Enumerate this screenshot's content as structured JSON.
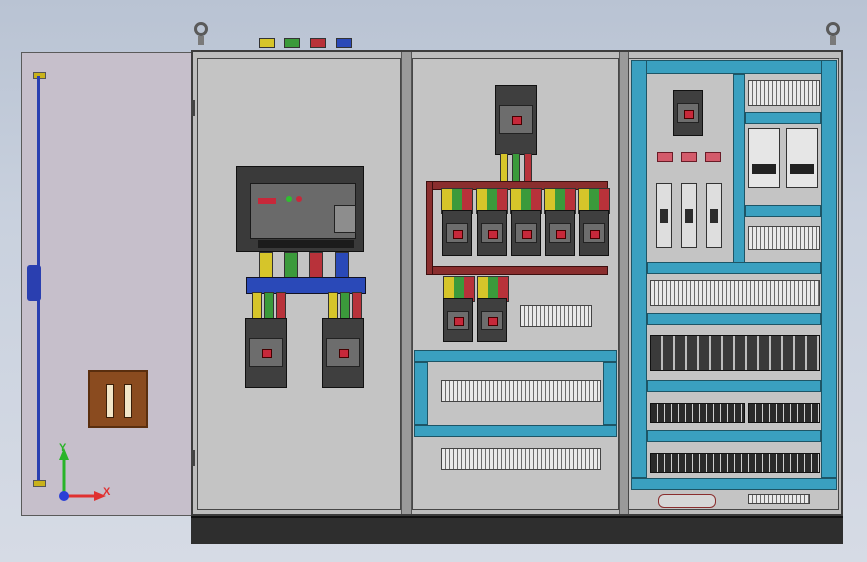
{
  "scene": {
    "description_free": true,
    "busbar_colors": {
      "phase_l1": "#d6c52a",
      "phase_l2": "#3b9a3b",
      "phase_l3": "#b8323a",
      "neutral": "#2a49b8"
    },
    "palette": {
      "background": "#c9d1de",
      "door": "#c6bfcb",
      "cabinet_frame": "#3c3c3c",
      "mounting_plate": "#c4c4c4",
      "cable_duct": "#3aa0c0",
      "copper_busbar": "#8a2e2e",
      "handle": "#8a4b1f",
      "plinth": "#2e2e2e"
    },
    "icons": [
      "lifting-eye-icon",
      "door-handle-icon",
      "axis-triad-icon"
    ]
  },
  "axis_triad": {
    "x_label": "X",
    "y_label": "Y",
    "x_color": "#e03030",
    "y_color": "#28b428",
    "z_color": "#2a3fd6"
  }
}
